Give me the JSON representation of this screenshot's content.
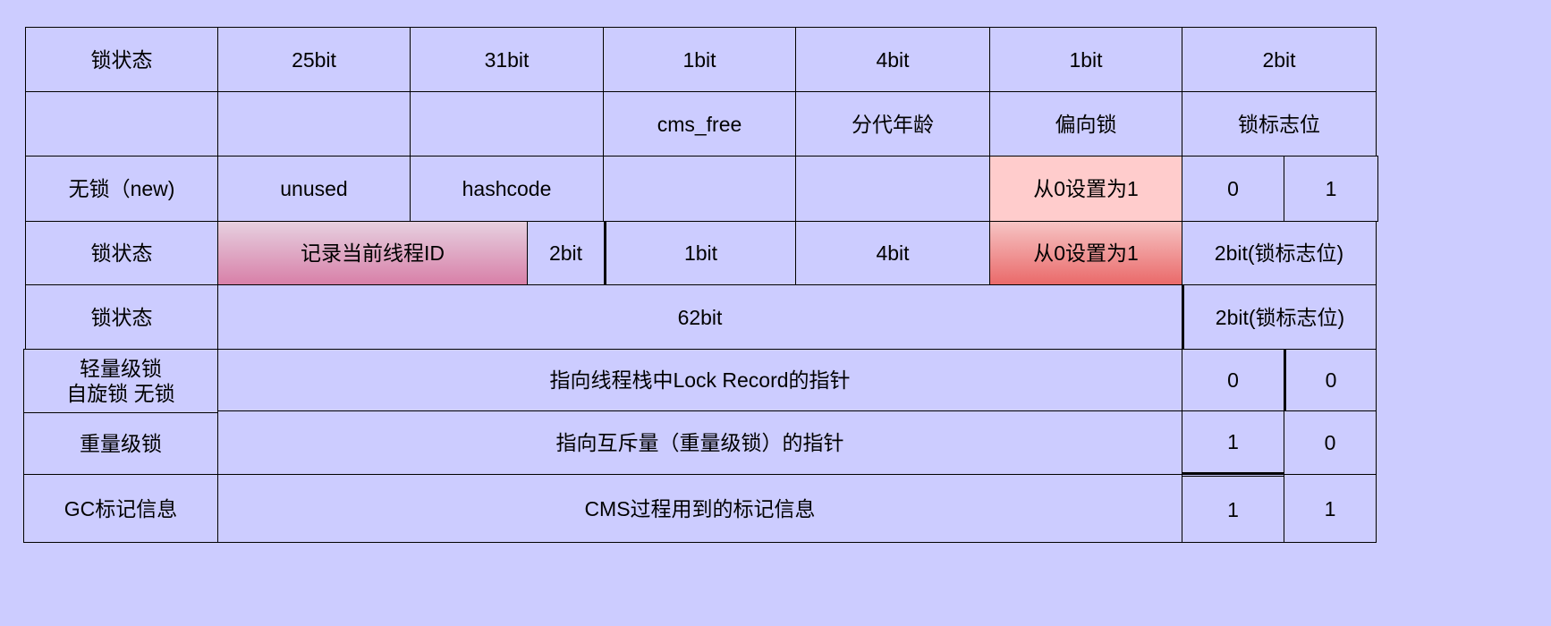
{
  "diagram": {
    "title": "",
    "rows": [
      {
        "name": "header-bits",
        "cells": [
          {
            "name": "row1-label",
            "text": "锁状态"
          },
          {
            "name": "row1-25bit",
            "text": "25bit"
          },
          {
            "name": "row1-31bit",
            "text": "31bit"
          },
          {
            "name": "row1-1bit-a",
            "text": "1bit"
          },
          {
            "name": "row1-4bit",
            "text": "4bit"
          },
          {
            "name": "row1-1bit-b",
            "text": "1bit"
          },
          {
            "name": "row1-2bit",
            "text": "2bit"
          }
        ]
      },
      {
        "name": "header-fields",
        "cells": [
          {
            "name": "row2-label",
            "text": ""
          },
          {
            "name": "row2-empty-a",
            "text": ""
          },
          {
            "name": "row2-empty-b",
            "text": ""
          },
          {
            "name": "row2-cms-free",
            "text": "cms_free"
          },
          {
            "name": "row2-age",
            "text": "分代年龄"
          },
          {
            "name": "row2-biased",
            "text": "偏向锁"
          },
          {
            "name": "row2-lock-flag",
            "text": "锁标志位"
          }
        ]
      },
      {
        "name": "unlocked",
        "cells": [
          {
            "name": "row3-label",
            "text": "无锁（new)"
          },
          {
            "name": "row3-unused",
            "text": "unused"
          },
          {
            "name": "row3-hashcode",
            "text": "hashcode"
          },
          {
            "name": "row3-empty-a",
            "text": ""
          },
          {
            "name": "row3-empty-b",
            "text": ""
          },
          {
            "name": "row3-biased-set",
            "text": "从0设置为1"
          },
          {
            "name": "row3-flag-0",
            "text": "0"
          },
          {
            "name": "row3-flag-1",
            "text": "1"
          }
        ]
      },
      {
        "name": "biased",
        "cells": [
          {
            "name": "row4-label",
            "text": "锁状态"
          },
          {
            "name": "row4-thread-id",
            "text": "记录当前线程ID"
          },
          {
            "name": "row4-2bit",
            "text": "2bit"
          },
          {
            "name": "row4-1bit",
            "text": "1bit"
          },
          {
            "name": "row4-4bit",
            "text": "4bit"
          },
          {
            "name": "row4-biased-set",
            "text": "从0设置为1"
          },
          {
            "name": "row4-lock-flag",
            "text": "2bit(锁标志位)"
          }
        ]
      },
      {
        "name": "layout-62bit",
        "cells": [
          {
            "name": "row5-label",
            "text": "锁状态"
          },
          {
            "name": "row5-62bit",
            "text": "62bit"
          },
          {
            "name": "row5-lock-flag",
            "text": "2bit(锁标志位)"
          }
        ]
      },
      {
        "name": "lightweight",
        "cells": [
          {
            "name": "row6-label",
            "text": "轻量级锁\n自旋锁 无锁"
          },
          {
            "name": "row6-pointer",
            "text": "指向线程栈中Lock Record的指针"
          },
          {
            "name": "row6-flag-0a",
            "text": "0"
          },
          {
            "name": "row6-flag-0b",
            "text": "0"
          }
        ]
      },
      {
        "name": "heavyweight",
        "cells": [
          {
            "name": "row7-label",
            "text": "重量级锁"
          },
          {
            "name": "row7-pointer",
            "text": "指向互斥量（重量级锁）的指针"
          },
          {
            "name": "row7-flag-1",
            "text": "1"
          },
          {
            "name": "row7-flag-0",
            "text": "0"
          }
        ]
      },
      {
        "name": "gc-mark",
        "cells": [
          {
            "name": "row8-label",
            "text": "GC标记信息"
          },
          {
            "name": "row8-cms",
            "text": "CMS过程用到的标记信息"
          },
          {
            "name": "row8-flag-1a",
            "text": "1"
          },
          {
            "name": "row8-flag-1b",
            "text": "1"
          }
        ]
      }
    ]
  },
  "colors": {
    "background": "#ccccff",
    "border": "#000000",
    "highlight_pink": "#ffcccc",
    "gradient_mauve_top": "#e6d0e0",
    "gradient_mauve_bottom": "#d880a8",
    "gradient_red_top": "#f6c4c4",
    "gradient_red_bottom": "#ea6a6a"
  }
}
